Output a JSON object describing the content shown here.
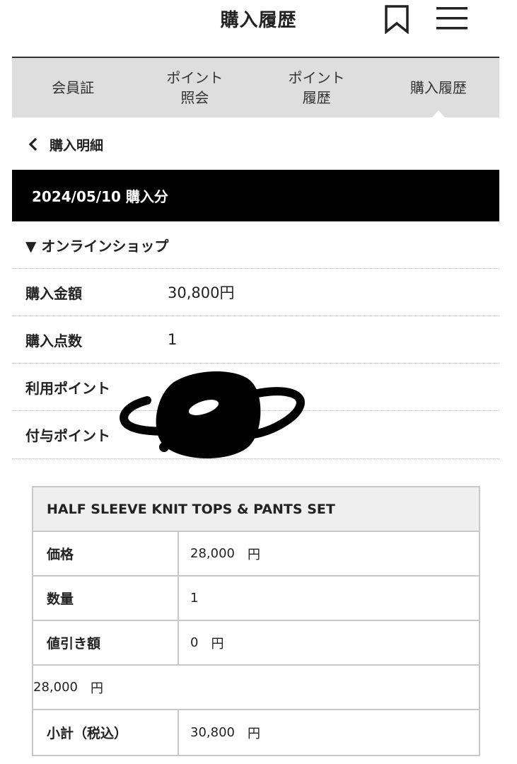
{
  "header": {
    "title": "購入履歴"
  },
  "tabs": [
    {
      "label": "会員証",
      "active": false
    },
    {
      "label": "ポイント\n照会",
      "active": false
    },
    {
      "label": "ポイント\n履歴",
      "active": false
    },
    {
      "label": "購入履歴",
      "active": true
    }
  ],
  "back": {
    "label": "購入明細"
  },
  "purchase": {
    "date_heading": "2024/05/10 購入分",
    "shop_label": "▼ オンラインショップ",
    "rows": [
      {
        "label": "購入金額",
        "value": "30,800円"
      },
      {
        "label": "購入点数",
        "value": "1"
      },
      {
        "label": "利用ポイント",
        "value": ""
      },
      {
        "label": "付与ポイント",
        "value": ""
      }
    ]
  },
  "product": {
    "name": "HALF SLEEVE KNIT TOPS & PANTS SET",
    "price_label": "価格",
    "price_value": "28,000",
    "price_unit": "円",
    "qty_label": "数量",
    "qty_value": "1",
    "discount_label": "値引き額",
    "discount_value": "0",
    "discount_unit": "円",
    "wide_value": "28,000",
    "wide_unit": "円",
    "subtotal_label": "小計（税込）",
    "subtotal_value": "30,800",
    "subtotal_unit": "円"
  },
  "icons": {
    "bookmark": "bookmark-icon",
    "menu": "hamburger-menu-icon",
    "back": "chevron-left-icon"
  },
  "colors": {
    "band": "#000000",
    "tabs_bg": "#dedede",
    "table_head_bg": "#efefef",
    "border": "#c8c8c8"
  }
}
